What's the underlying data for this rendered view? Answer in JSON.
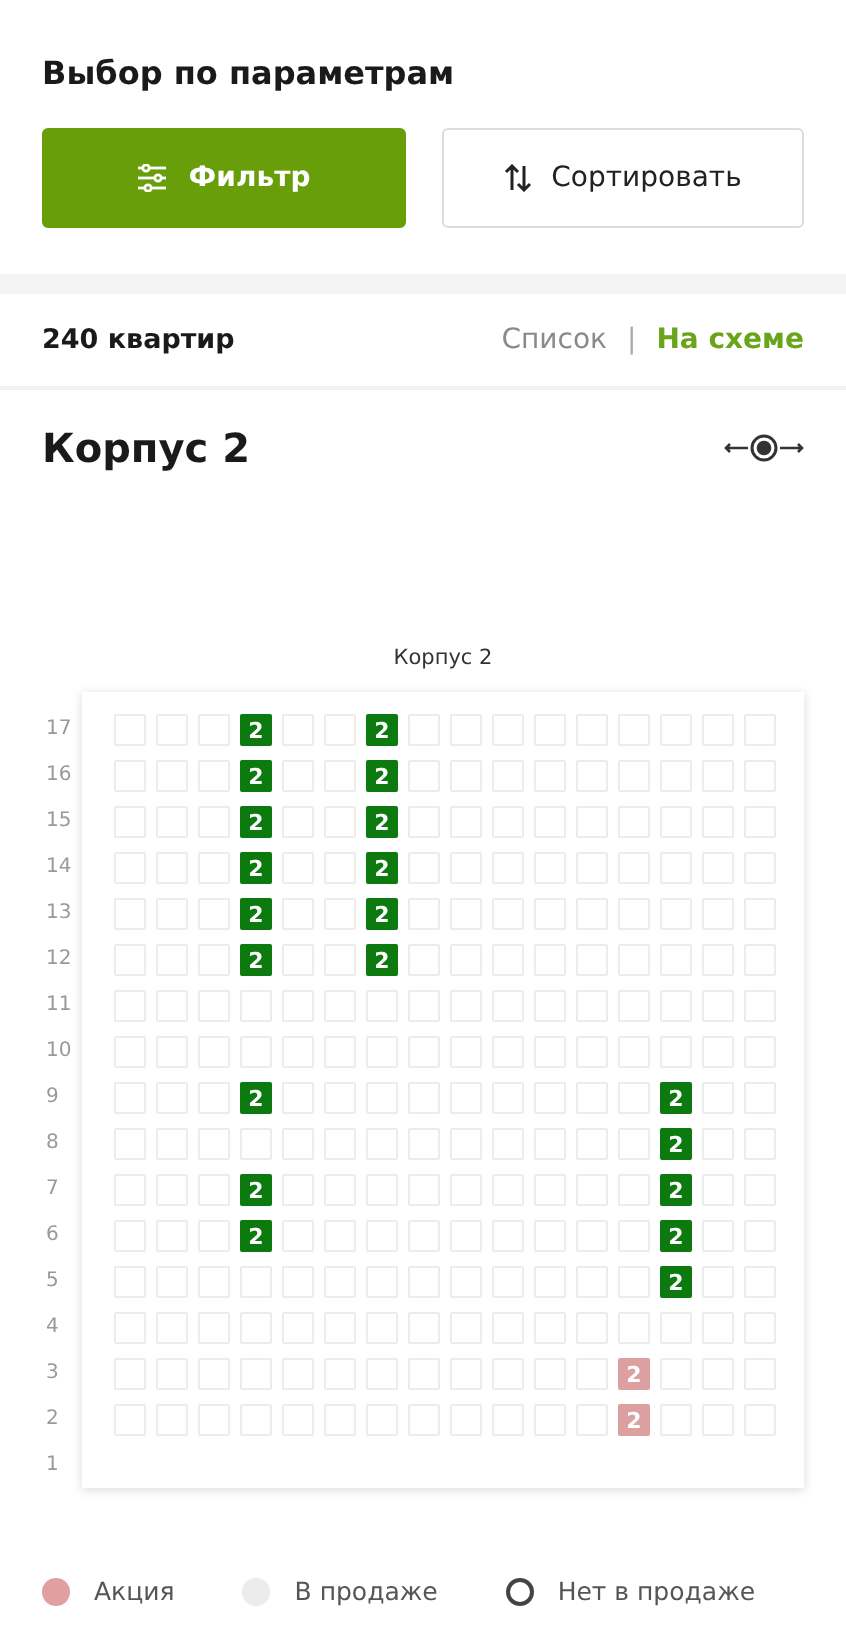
{
  "header": {
    "title": "Выбор по параметрам"
  },
  "buttons": [
    {
      "label": "Фильтр",
      "kind": "primary"
    },
    {
      "label": "Сортировать",
      "kind": "secondary"
    }
  ],
  "results": {
    "count": "240 квартир",
    "views": [
      {
        "label": "Список",
        "selected": false
      },
      {
        "label": "На схеме",
        "selected": true
      }
    ],
    "separator": "|"
  },
  "building": {
    "title": "Корпус 2",
    "scheme_title": "Корпус 2",
    "floors": [
      {
        "label": "17",
        "cells": [
          {
            "kind": "none"
          },
          {
            "kind": "none"
          },
          {
            "kind": "none"
          },
          {
            "kind": "available",
            "rooms": "2"
          },
          {
            "kind": "none"
          },
          {
            "kind": "none"
          },
          {
            "kind": "available",
            "rooms": "2"
          },
          {
            "kind": "none"
          },
          {
            "kind": "none"
          },
          {
            "kind": "none"
          },
          {
            "kind": "none"
          },
          {
            "kind": "none"
          },
          {
            "kind": "none"
          },
          {
            "kind": "none"
          },
          {
            "kind": "none"
          },
          {
            "kind": "none"
          }
        ]
      },
      {
        "label": "16",
        "cells": [
          {
            "kind": "none"
          },
          {
            "kind": "none"
          },
          {
            "kind": "none"
          },
          {
            "kind": "available",
            "rooms": "2"
          },
          {
            "kind": "none"
          },
          {
            "kind": "none"
          },
          {
            "kind": "available",
            "rooms": "2"
          },
          {
            "kind": "none"
          },
          {
            "kind": "none"
          },
          {
            "kind": "none"
          },
          {
            "kind": "none"
          },
          {
            "kind": "none"
          },
          {
            "kind": "none"
          },
          {
            "kind": "none"
          },
          {
            "kind": "none"
          },
          {
            "kind": "none"
          }
        ]
      },
      {
        "label": "15",
        "cells": [
          {
            "kind": "none"
          },
          {
            "kind": "none"
          },
          {
            "kind": "none"
          },
          {
            "kind": "available",
            "rooms": "2"
          },
          {
            "kind": "none"
          },
          {
            "kind": "none"
          },
          {
            "kind": "available",
            "rooms": "2"
          },
          {
            "kind": "none"
          },
          {
            "kind": "none"
          },
          {
            "kind": "none"
          },
          {
            "kind": "none"
          },
          {
            "kind": "none"
          },
          {
            "kind": "none"
          },
          {
            "kind": "none"
          },
          {
            "kind": "none"
          },
          {
            "kind": "none"
          }
        ]
      },
      {
        "label": "14",
        "cells": [
          {
            "kind": "none"
          },
          {
            "kind": "none"
          },
          {
            "kind": "none"
          },
          {
            "kind": "available",
            "rooms": "2"
          },
          {
            "kind": "none"
          },
          {
            "kind": "none"
          },
          {
            "kind": "available",
            "rooms": "2"
          },
          {
            "kind": "none"
          },
          {
            "kind": "none"
          },
          {
            "kind": "none"
          },
          {
            "kind": "none"
          },
          {
            "kind": "none"
          },
          {
            "kind": "none"
          },
          {
            "kind": "none"
          },
          {
            "kind": "none"
          },
          {
            "kind": "none"
          }
        ]
      },
      {
        "label": "13",
        "cells": [
          {
            "kind": "none"
          },
          {
            "kind": "none"
          },
          {
            "kind": "none"
          },
          {
            "kind": "available",
            "rooms": "2"
          },
          {
            "kind": "none"
          },
          {
            "kind": "none"
          },
          {
            "kind": "available",
            "rooms": "2"
          },
          {
            "kind": "none"
          },
          {
            "kind": "none"
          },
          {
            "kind": "none"
          },
          {
            "kind": "none"
          },
          {
            "kind": "none"
          },
          {
            "kind": "none"
          },
          {
            "kind": "none"
          },
          {
            "kind": "none"
          },
          {
            "kind": "none"
          }
        ]
      },
      {
        "label": "12",
        "cells": [
          {
            "kind": "none"
          },
          {
            "kind": "none"
          },
          {
            "kind": "none"
          },
          {
            "kind": "available",
            "rooms": "2"
          },
          {
            "kind": "none"
          },
          {
            "kind": "none"
          },
          {
            "kind": "available",
            "rooms": "2"
          },
          {
            "kind": "none"
          },
          {
            "kind": "none"
          },
          {
            "kind": "none"
          },
          {
            "kind": "none"
          },
          {
            "kind": "none"
          },
          {
            "kind": "none"
          },
          {
            "kind": "none"
          },
          {
            "kind": "none"
          },
          {
            "kind": "none"
          }
        ]
      },
      {
        "label": "11",
        "cells": [
          {
            "kind": "none"
          },
          {
            "kind": "none"
          },
          {
            "kind": "none"
          },
          {
            "kind": "none"
          },
          {
            "kind": "none"
          },
          {
            "kind": "none"
          },
          {
            "kind": "none"
          },
          {
            "kind": "none"
          },
          {
            "kind": "none"
          },
          {
            "kind": "none"
          },
          {
            "kind": "none"
          },
          {
            "kind": "none"
          },
          {
            "kind": "none"
          },
          {
            "kind": "none"
          },
          {
            "kind": "none"
          },
          {
            "kind": "none"
          }
        ]
      },
      {
        "label": "10",
        "cells": [
          {
            "kind": "none"
          },
          {
            "kind": "none"
          },
          {
            "kind": "none"
          },
          {
            "kind": "none"
          },
          {
            "kind": "none"
          },
          {
            "kind": "none"
          },
          {
            "kind": "none"
          },
          {
            "kind": "none"
          },
          {
            "kind": "none"
          },
          {
            "kind": "none"
          },
          {
            "kind": "none"
          },
          {
            "kind": "none"
          },
          {
            "kind": "none"
          },
          {
            "kind": "none"
          },
          {
            "kind": "none"
          },
          {
            "kind": "none"
          }
        ]
      },
      {
        "label": "9",
        "cells": [
          {
            "kind": "none"
          },
          {
            "kind": "none"
          },
          {
            "kind": "none"
          },
          {
            "kind": "available",
            "rooms": "2"
          },
          {
            "kind": "none"
          },
          {
            "kind": "none"
          },
          {
            "kind": "none"
          },
          {
            "kind": "none"
          },
          {
            "kind": "none"
          },
          {
            "kind": "none"
          },
          {
            "kind": "none"
          },
          {
            "kind": "none"
          },
          {
            "kind": "none"
          },
          {
            "kind": "available",
            "rooms": "2"
          },
          {
            "kind": "none"
          },
          {
            "kind": "none"
          }
        ]
      },
      {
        "label": "8",
        "cells": [
          {
            "kind": "none"
          },
          {
            "kind": "none"
          },
          {
            "kind": "none"
          },
          {
            "kind": "none"
          },
          {
            "kind": "none"
          },
          {
            "kind": "none"
          },
          {
            "kind": "none"
          },
          {
            "kind": "none"
          },
          {
            "kind": "none"
          },
          {
            "kind": "none"
          },
          {
            "kind": "none"
          },
          {
            "kind": "none"
          },
          {
            "kind": "none"
          },
          {
            "kind": "available",
            "rooms": "2"
          },
          {
            "kind": "none"
          },
          {
            "kind": "none"
          }
        ]
      },
      {
        "label": "7",
        "cells": [
          {
            "kind": "none"
          },
          {
            "kind": "none"
          },
          {
            "kind": "none"
          },
          {
            "kind": "available",
            "rooms": "2"
          },
          {
            "kind": "none"
          },
          {
            "kind": "none"
          },
          {
            "kind": "none"
          },
          {
            "kind": "none"
          },
          {
            "kind": "none"
          },
          {
            "kind": "none"
          },
          {
            "kind": "none"
          },
          {
            "kind": "none"
          },
          {
            "kind": "none"
          },
          {
            "kind": "available",
            "rooms": "2"
          },
          {
            "kind": "none"
          },
          {
            "kind": "none"
          }
        ]
      },
      {
        "label": "6",
        "cells": [
          {
            "kind": "none"
          },
          {
            "kind": "none"
          },
          {
            "kind": "none"
          },
          {
            "kind": "available",
            "rooms": "2"
          },
          {
            "kind": "none"
          },
          {
            "kind": "none"
          },
          {
            "kind": "none"
          },
          {
            "kind": "none"
          },
          {
            "kind": "none"
          },
          {
            "kind": "none"
          },
          {
            "kind": "none"
          },
          {
            "kind": "none"
          },
          {
            "kind": "none"
          },
          {
            "kind": "available",
            "rooms": "2"
          },
          {
            "kind": "none"
          },
          {
            "kind": "none"
          }
        ]
      },
      {
        "label": "5",
        "cells": [
          {
            "kind": "none"
          },
          {
            "kind": "none"
          },
          {
            "kind": "none"
          },
          {
            "kind": "none"
          },
          {
            "kind": "none"
          },
          {
            "kind": "none"
          },
          {
            "kind": "none"
          },
          {
            "kind": "none"
          },
          {
            "kind": "none"
          },
          {
            "kind": "none"
          },
          {
            "kind": "none"
          },
          {
            "kind": "none"
          },
          {
            "kind": "none"
          },
          {
            "kind": "available",
            "rooms": "2"
          },
          {
            "kind": "none"
          },
          {
            "kind": "none"
          }
        ]
      },
      {
        "label": "4",
        "cells": [
          {
            "kind": "none"
          },
          {
            "kind": "none"
          },
          {
            "kind": "none"
          },
          {
            "kind": "none"
          },
          {
            "kind": "none"
          },
          {
            "kind": "none"
          },
          {
            "kind": "none"
          },
          {
            "kind": "none"
          },
          {
            "kind": "none"
          },
          {
            "kind": "none"
          },
          {
            "kind": "none"
          },
          {
            "kind": "none"
          },
          {
            "kind": "none"
          },
          {
            "kind": "none"
          },
          {
            "kind": "none"
          },
          {
            "kind": "none"
          }
        ]
      },
      {
        "label": "3",
        "cells": [
          {
            "kind": "none"
          },
          {
            "kind": "none"
          },
          {
            "kind": "none"
          },
          {
            "kind": "none"
          },
          {
            "kind": "none"
          },
          {
            "kind": "none"
          },
          {
            "kind": "none"
          },
          {
            "kind": "none"
          },
          {
            "kind": "none"
          },
          {
            "kind": "none"
          },
          {
            "kind": "none"
          },
          {
            "kind": "none"
          },
          {
            "kind": "promo",
            "rooms": "2"
          },
          {
            "kind": "none"
          },
          {
            "kind": "none"
          },
          {
            "kind": "none"
          }
        ]
      },
      {
        "label": "2",
        "cells": [
          {
            "kind": "none"
          },
          {
            "kind": "none"
          },
          {
            "kind": "none"
          },
          {
            "kind": "none"
          },
          {
            "kind": "none"
          },
          {
            "kind": "none"
          },
          {
            "kind": "none"
          },
          {
            "kind": "none"
          },
          {
            "kind": "none"
          },
          {
            "kind": "none"
          },
          {
            "kind": "none"
          },
          {
            "kind": "none"
          },
          {
            "kind": "promo",
            "rooms": "2"
          },
          {
            "kind": "none"
          },
          {
            "kind": "none"
          },
          {
            "kind": "none"
          }
        ]
      },
      {
        "label": "1"
      }
    ]
  },
  "legend": [
    {
      "label": "Акция",
      "kind": "filled",
      "color": "#e0a0a0"
    },
    {
      "label": "В продаже",
      "kind": "filled",
      "color": "#ececec"
    },
    {
      "label": "Нет в продаже",
      "kind": "outline",
      "color": "#444444"
    }
  ]
}
